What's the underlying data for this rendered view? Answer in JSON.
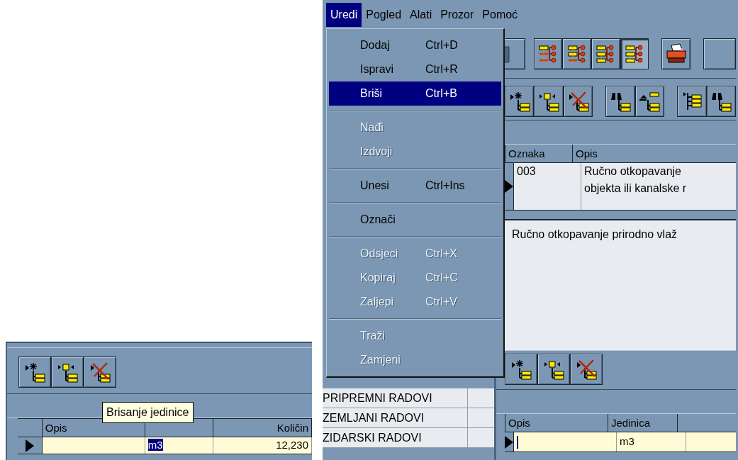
{
  "left_window": {
    "grid": {
      "columns": [
        "Opis",
        "",
        "Količin"
      ],
      "rows": [
        {
          "current": true,
          "cells": [
            {
              "selected": false
            },
            {
              "text": "m3",
              "selected": true
            },
            {
              "text": "12,230",
              "selected": false
            }
          ]
        }
      ]
    },
    "tooltip": "Brisanje jedinice"
  },
  "right_window": {
    "menubar": [
      {
        "label": "Uredi",
        "selected": true
      },
      {
        "label": "Pogled",
        "selected": false
      },
      {
        "label": "Alati",
        "selected": false
      },
      {
        "label": "Prozor",
        "selected": false
      },
      {
        "label": "Pomoć",
        "selected": false
      }
    ],
    "view_buttons": [
      {
        "selected": false
      },
      {
        "selected": false
      },
      {
        "selected": false
      },
      {
        "selected": true
      }
    ],
    "category_list": [
      {
        "label": "PRIPREMNI RADOVI"
      },
      {
        "label": "ZEMLJANI RADOVI"
      },
      {
        "label": "ZIDARSKI RADOVI"
      }
    ],
    "items_grid": {
      "columns": [
        "Oznaka",
        "Opis"
      ],
      "rows": [
        {
          "current": true,
          "cells": [
            "003",
            "Ručno otkopavanje\nobjekta ili kanalske r"
          ]
        }
      ]
    },
    "description": "Ručno otkopavanje prirodno vlaž",
    "units_grid": {
      "columns": [
        "Opis",
        "Jedinica"
      ],
      "rows": [
        {
          "current": true,
          "cells": [
            {
              "editing": true
            },
            {
              "text": "m3",
              "editing": false
            }
          ]
        }
      ]
    },
    "edit_menu": [
      {
        "kind": "item",
        "label": "Dodaj",
        "shortcut": "Ctrl+D",
        "selected": false,
        "disabled": false
      },
      {
        "kind": "item",
        "label": "Ispravi",
        "shortcut": "Ctrl+R",
        "selected": false,
        "disabled": false
      },
      {
        "kind": "item",
        "label": "Briši",
        "shortcut": "Ctrl+B",
        "selected": true,
        "disabled": false
      },
      {
        "kind": "separator"
      },
      {
        "kind": "item",
        "label": "Nađi",
        "selected": false,
        "disabled": true
      },
      {
        "kind": "item",
        "label": "Izdvoji",
        "selected": false,
        "disabled": true
      },
      {
        "kind": "separator"
      },
      {
        "kind": "item",
        "label": "Unesi",
        "shortcut": "Ctrl+Ins",
        "selected": false,
        "disabled": false
      },
      {
        "kind": "separator"
      },
      {
        "kind": "item",
        "label": "Označi",
        "selected": false,
        "disabled": false
      },
      {
        "kind": "separator"
      },
      {
        "kind": "item",
        "label": "Odsjeci",
        "shortcut": "Ctrl+X",
        "selected": false,
        "disabled": true
      },
      {
        "kind": "item",
        "label": "Kopiraj",
        "shortcut": "Ctrl+C",
        "selected": false,
        "disabled": true
      },
      {
        "kind": "item",
        "label": "Zaljepi",
        "shortcut": "Ctrl+V",
        "selected": false,
        "disabled": true
      },
      {
        "kind": "separator"
      },
      {
        "kind": "item",
        "label": "Traži",
        "selected": false,
        "disabled": true
      },
      {
        "kind": "item",
        "label": "Zamjeni",
        "selected": false,
        "disabled": true
      }
    ]
  }
}
